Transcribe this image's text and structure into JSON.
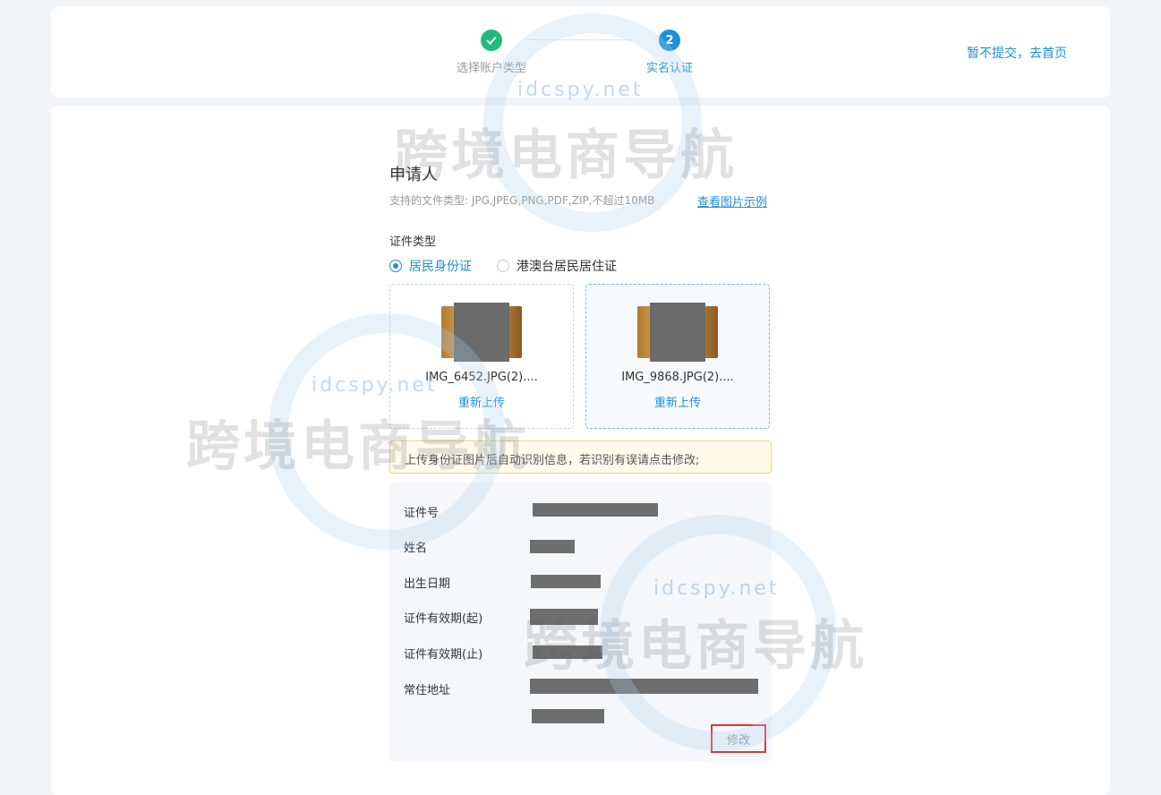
{
  "steps": [
    {
      "label": "选择账户类型",
      "status": "done",
      "icon": "check-icon"
    },
    {
      "label": "实名认证",
      "status": "active",
      "number": "2"
    }
  ],
  "header": {
    "skip_link": "暂不提交，去首页"
  },
  "form": {
    "title": "申请人",
    "file_types": "支持的文件类型: JPG,JPEG,PNG,PDF,ZIP,不超过10MB",
    "example_link": "查看图片示例",
    "id_type_label": "证件类型",
    "id_types": [
      {
        "label": "居民身份证",
        "checked": true
      },
      {
        "label": "港澳台居民居住证",
        "checked": false
      }
    ],
    "uploads": [
      {
        "filename": "IMG_6452.JPG(2)....",
        "action": "重新上传"
      },
      {
        "filename": "IMG_9868.JPG(2)....",
        "action": "重新上传"
      }
    ],
    "notice": "上传身份证图片后自动识别信息，若识别有误请点击修改;",
    "fields": [
      {
        "label": "证件号"
      },
      {
        "label": "姓名"
      },
      {
        "label": "出生日期"
      },
      {
        "label": "证件有效期(起)"
      },
      {
        "label": "证件有效期(止)"
      },
      {
        "label": "常住地址"
      }
    ],
    "edit_button": "修改"
  },
  "watermark": {
    "site": "idcspy.net",
    "brand": "跨境电商导航"
  },
  "colors": {
    "accent": "#1e8fd9",
    "success": "#1fba7c",
    "notice_border": "#f0d27c",
    "highlight": "#d9363e"
  }
}
